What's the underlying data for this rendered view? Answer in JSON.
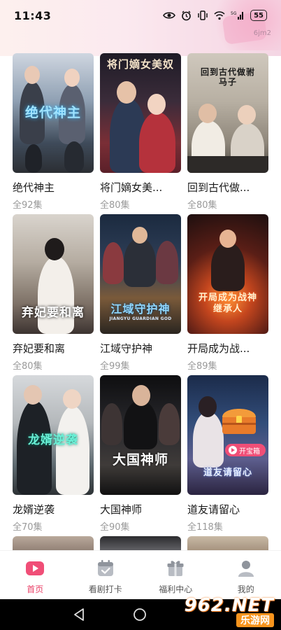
{
  "status": {
    "time": "11:43",
    "battery": "55"
  },
  "header": {
    "corner_tag": "6jm2"
  },
  "dramas": [
    {
      "title": "绝代神主",
      "episodes": "全92集",
      "poster_text": "绝代神主"
    },
    {
      "title": "将门嫡女美...",
      "episodes": "全80集",
      "poster_text": "将门嫡女美奴"
    },
    {
      "title": "回到古代做...",
      "episodes": "全80集",
      "poster_text": "回到古代做驸马子"
    },
    {
      "title": "弃妃要和离",
      "episodes": "全80集",
      "poster_text": "弃妃要和离"
    },
    {
      "title": "江域守护神",
      "episodes": "全99集",
      "poster_text": "江域守护神",
      "poster_subtext": "JIANGYU GUARDIAN GOD"
    },
    {
      "title": "开局成为战...",
      "episodes": "全89集",
      "poster_text": "开局成为战神继承人"
    },
    {
      "title": "龙婿逆袭",
      "episodes": "全70集",
      "poster_text": "龙婿逆袭"
    },
    {
      "title": "大国神师",
      "episodes": "全90集",
      "poster_text": "大国神师"
    },
    {
      "title": "道友请留心",
      "episodes": "全118集",
      "poster_text": "道友请留心"
    }
  ],
  "treasure_button": {
    "label": "开宝箱"
  },
  "bottom_nav": [
    {
      "label": "首页",
      "icon": "play-tv-icon",
      "active": true
    },
    {
      "label": "看剧打卡",
      "icon": "calendar-check-icon",
      "active": false
    },
    {
      "label": "福利中心",
      "icon": "gift-icon",
      "active": false
    },
    {
      "label": "我的",
      "icon": "user-icon",
      "active": false
    }
  ],
  "watermark": {
    "logo": "962.NET",
    "subtitle": "乐游网"
  },
  "colors": {
    "accent": "#e93d64",
    "muted_text": "#9a9a9a",
    "watermark_orange": "#f7941d"
  }
}
